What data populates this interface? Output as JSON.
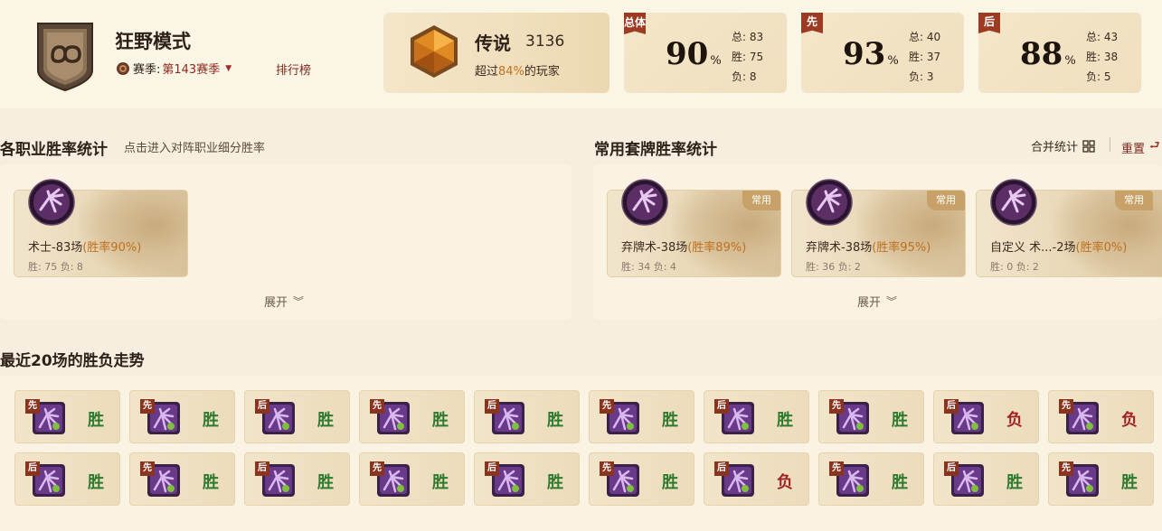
{
  "header": {
    "mode_title": "狂野模式",
    "season_label": "赛季:",
    "season_value": "第143赛季",
    "rank_link": "排行榜",
    "legend": {
      "name": "传说",
      "score": "3136",
      "sub_prefix": "超过",
      "sub_pct": "84%",
      "sub_suffix": "的玩家"
    },
    "stats": [
      {
        "tag": "总体",
        "value": "90",
        "unit": "%",
        "total": "总: 83",
        "wins": "胜: 75",
        "losses": "负: 8"
      },
      {
        "tag": "先",
        "value": "93",
        "unit": "%",
        "total": "总: 40",
        "wins": "胜: 37",
        "losses": "负: 3"
      },
      {
        "tag": "后",
        "value": "88",
        "unit": "%",
        "total": "总: 43",
        "wins": "胜: 38",
        "losses": "负: 5"
      }
    ]
  },
  "class_section": {
    "title": "各职业胜率统计",
    "hint": "点击进入对阵职业细分胜率",
    "cards": [
      {
        "name": "术士-83场",
        "rate": "(胜率90%)",
        "detail": "胜: 75 负: 8"
      }
    ],
    "expand": "展开"
  },
  "deck_section": {
    "title": "常用套牌胜率统计",
    "merge_label": "合并统计",
    "reset_label": "重置",
    "badge": "常用",
    "cards": [
      {
        "name": "弃牌术-38场",
        "rate": "(胜率89%)",
        "detail": "胜: 34 负: 4"
      },
      {
        "name": "弃牌术-38场",
        "rate": "(胜率95%)",
        "detail": "胜: 36 负: 2"
      },
      {
        "name": "自定义 术...-2场",
        "rate": "(胜率0%)",
        "detail": "胜: 0 负: 2"
      }
    ],
    "expand": "展开"
  },
  "trend_section": {
    "title": "最近20场的胜负走势",
    "games": [
      {
        "order": "先",
        "result": "胜"
      },
      {
        "order": "先",
        "result": "胜"
      },
      {
        "order": "后",
        "result": "胜"
      },
      {
        "order": "先",
        "result": "胜"
      },
      {
        "order": "后",
        "result": "胜"
      },
      {
        "order": "先",
        "result": "胜"
      },
      {
        "order": "后",
        "result": "胜"
      },
      {
        "order": "先",
        "result": "胜"
      },
      {
        "order": "后",
        "result": "负"
      },
      {
        "order": "先",
        "result": "负"
      },
      {
        "order": "后",
        "result": "胜"
      },
      {
        "order": "先",
        "result": "胜"
      },
      {
        "order": "后",
        "result": "胜"
      },
      {
        "order": "先",
        "result": "胜"
      },
      {
        "order": "后",
        "result": "胜"
      },
      {
        "order": "先",
        "result": "胜"
      },
      {
        "order": "后",
        "result": "负"
      },
      {
        "order": "先",
        "result": "胜"
      },
      {
        "order": "后",
        "result": "胜"
      },
      {
        "order": "先",
        "result": "胜"
      }
    ]
  },
  "colors": {
    "accent": "#c0701e",
    "win": "#2e7a2e",
    "loss": "#a02424",
    "tag": "#9d3a22"
  },
  "icons": {
    "mode": "wild-mode-emblem-icon",
    "season": "season-gear-icon",
    "legend": "legend-rank-gem-icon",
    "class": "warlock-class-icon",
    "merge": "grid-icon",
    "reset": "reset-arrow-icon",
    "expand": "chevron-down-icon"
  }
}
